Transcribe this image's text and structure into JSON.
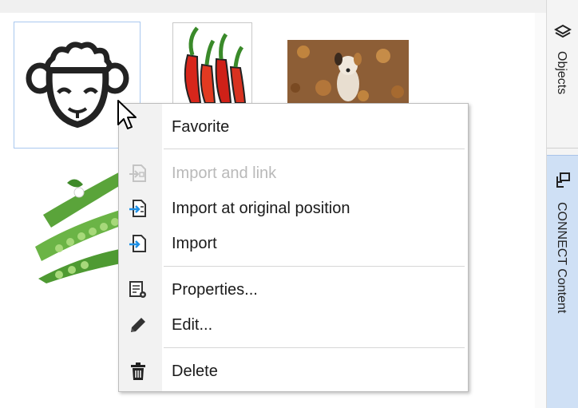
{
  "dock": {
    "objects_label": "Objects",
    "connect_label": "CONNECT Content"
  },
  "thumbnails": [
    {
      "name": "sheep",
      "icon": "sheep-icon"
    },
    {
      "name": "chili peppers",
      "icon": "chili-icon"
    },
    {
      "name": "dog photo",
      "icon": "dog-photo"
    },
    {
      "name": "peas photo",
      "icon": "peas-photo"
    }
  ],
  "menu": {
    "items": [
      {
        "label": "Favorite",
        "icon": "",
        "enabled": true
      },
      {
        "label": "Import and link",
        "icon": "import-link-icon",
        "enabled": false
      },
      {
        "label": "Import at original position",
        "icon": "import-original-icon",
        "enabled": true
      },
      {
        "label": "Import",
        "icon": "import-icon",
        "enabled": true
      },
      {
        "label": "Properties...",
        "icon": "properties-icon",
        "enabled": true
      },
      {
        "label": "Edit...",
        "icon": "pencil-icon",
        "enabled": true
      },
      {
        "label": "Delete",
        "icon": "trash-icon",
        "enabled": true
      }
    ]
  },
  "colors": {
    "accent_blue": "#1e90e6",
    "dock_active": "#cfe0f5",
    "selection_border": "#a9c8ef"
  }
}
